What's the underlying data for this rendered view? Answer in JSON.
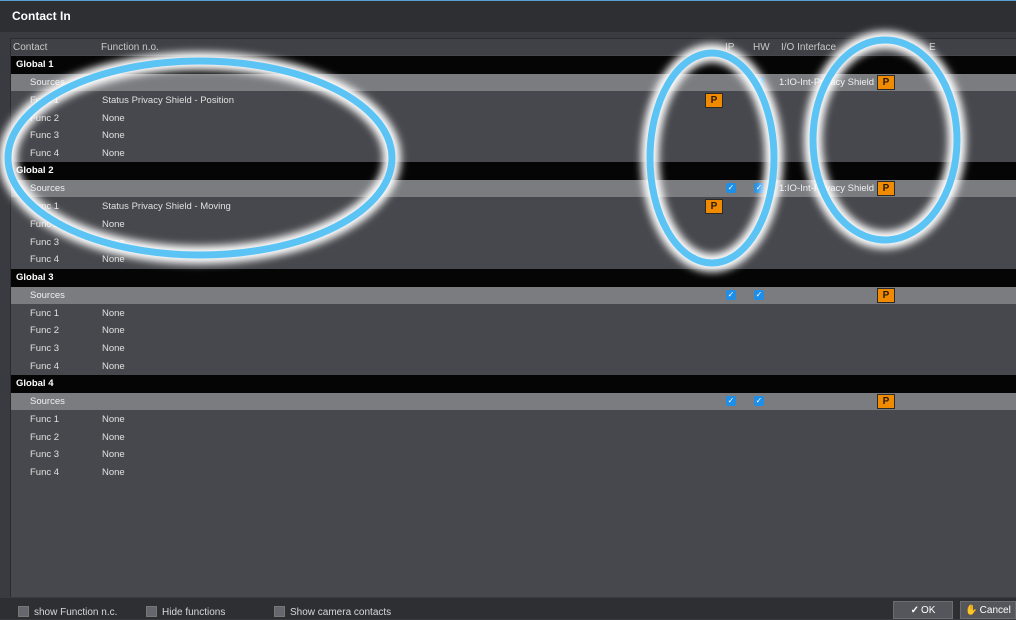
{
  "window": {
    "title": "Contact In"
  },
  "columns": {
    "contact": "Contact",
    "function": "Function n.o.",
    "ip": "IP",
    "hw": "HW",
    "io": "I/O Interface",
    "extra": "E"
  },
  "groups": [
    {
      "label": "Global 1",
      "sources": {
        "label": "Sources",
        "ip": false,
        "hw": true,
        "io": "1:IO-Int-Privacy Shield",
        "p": "P"
      },
      "funcs": [
        {
          "label": "Func 1",
          "value": "Status Privacy Shield - Position",
          "p": "P"
        },
        {
          "label": "Func 2",
          "value": "None"
        },
        {
          "label": "Func 3",
          "value": "None"
        },
        {
          "label": "Func 4",
          "value": "None"
        }
      ]
    },
    {
      "label": "Global 2",
      "sources": {
        "label": "Sources",
        "ip": true,
        "hw": true,
        "io": "1:IO-Int-Privacy Shield",
        "p": "P"
      },
      "funcs": [
        {
          "label": "Func 1",
          "value": "Status Privacy Shield - Moving",
          "p": "P"
        },
        {
          "label": "Func 2",
          "value": "None"
        },
        {
          "label": "Func 3",
          "value": "None"
        },
        {
          "label": "Func 4",
          "value": "None"
        }
      ]
    },
    {
      "label": "Global 3",
      "sources": {
        "label": "Sources",
        "ip": true,
        "hw": true,
        "io": "",
        "p": "P"
      },
      "funcs": [
        {
          "label": "Func 1",
          "value": "None"
        },
        {
          "label": "Func 2",
          "value": "None"
        },
        {
          "label": "Func 3",
          "value": "None"
        },
        {
          "label": "Func 4",
          "value": "None"
        }
      ]
    },
    {
      "label": "Global 4",
      "sources": {
        "label": "Sources",
        "ip": true,
        "hw": true,
        "io": "",
        "p": "P"
      },
      "funcs": [
        {
          "label": "Func 1",
          "value": "None"
        },
        {
          "label": "Func 2",
          "value": "None"
        },
        {
          "label": "Func 3",
          "value": "None"
        },
        {
          "label": "Func 4",
          "value": "None"
        }
      ]
    }
  ],
  "footer": {
    "show_function_nc": "show Function n.c.",
    "hide_functions": "Hide functions",
    "show_camera_contacts": "Show camera contacts",
    "ok": "OK",
    "cancel": "Cancel"
  },
  "icons": {
    "check": "checkmark-icon",
    "hand": "hand-icon"
  },
  "colors": {
    "accent": "#1e8ee6",
    "badge": "#f08a00",
    "highlight": "#5bc4f5"
  }
}
